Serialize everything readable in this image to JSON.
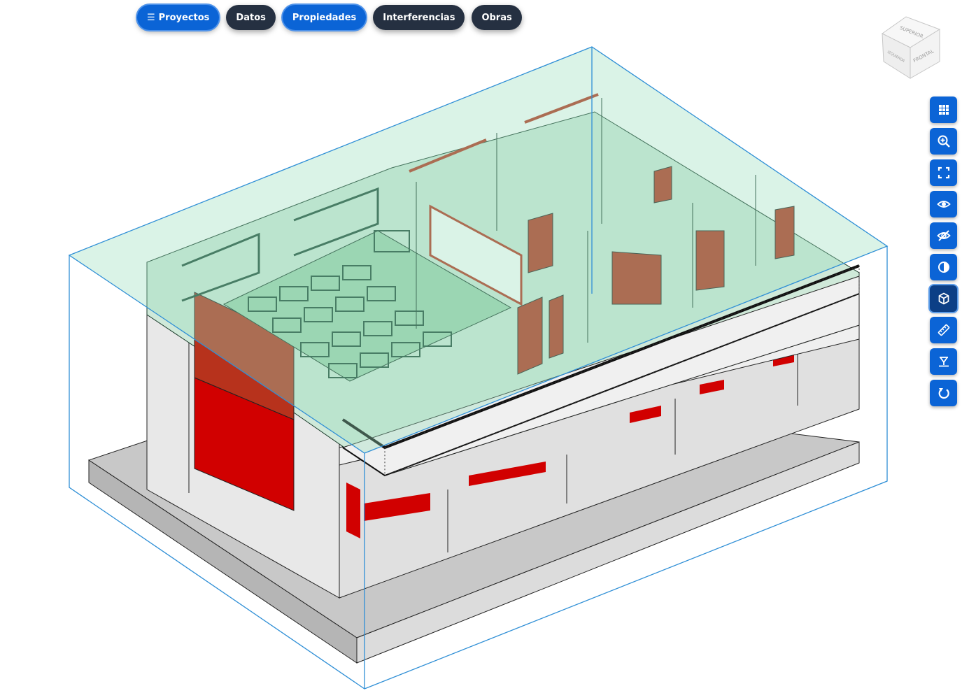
{
  "nav": {
    "projects_icon": "☰",
    "projects_label": "Proyectos",
    "data_label": "Datos",
    "properties_label": "Propiedades",
    "clashes_label": "Interferencias",
    "works_label": "Obras"
  },
  "viewcube": {
    "top_label": "SUPERIOR",
    "left_label": "IZQUIERDA",
    "front_label": "FRONTAL"
  },
  "toolbar": [
    {
      "icon": "grid-icon"
    },
    {
      "icon": "zoom-in-icon"
    },
    {
      "icon": "fit-view-icon"
    },
    {
      "icon": "show-icon"
    },
    {
      "icon": "hide-icon"
    },
    {
      "icon": "contrast-icon"
    },
    {
      "icon": "cube-icon",
      "active": true
    },
    {
      "icon": "measure-icon"
    },
    {
      "icon": "section-plane-icon"
    },
    {
      "icon": "reset-icon"
    }
  ],
  "colors": {
    "accent": "#0b64d6",
    "dark_pill": "#253041",
    "section_box": "#2f8fd6",
    "section_fill": "#bfeed6",
    "walls": "#e6e6e6",
    "red_panels": "#d10000",
    "doors": "#b7321c"
  }
}
